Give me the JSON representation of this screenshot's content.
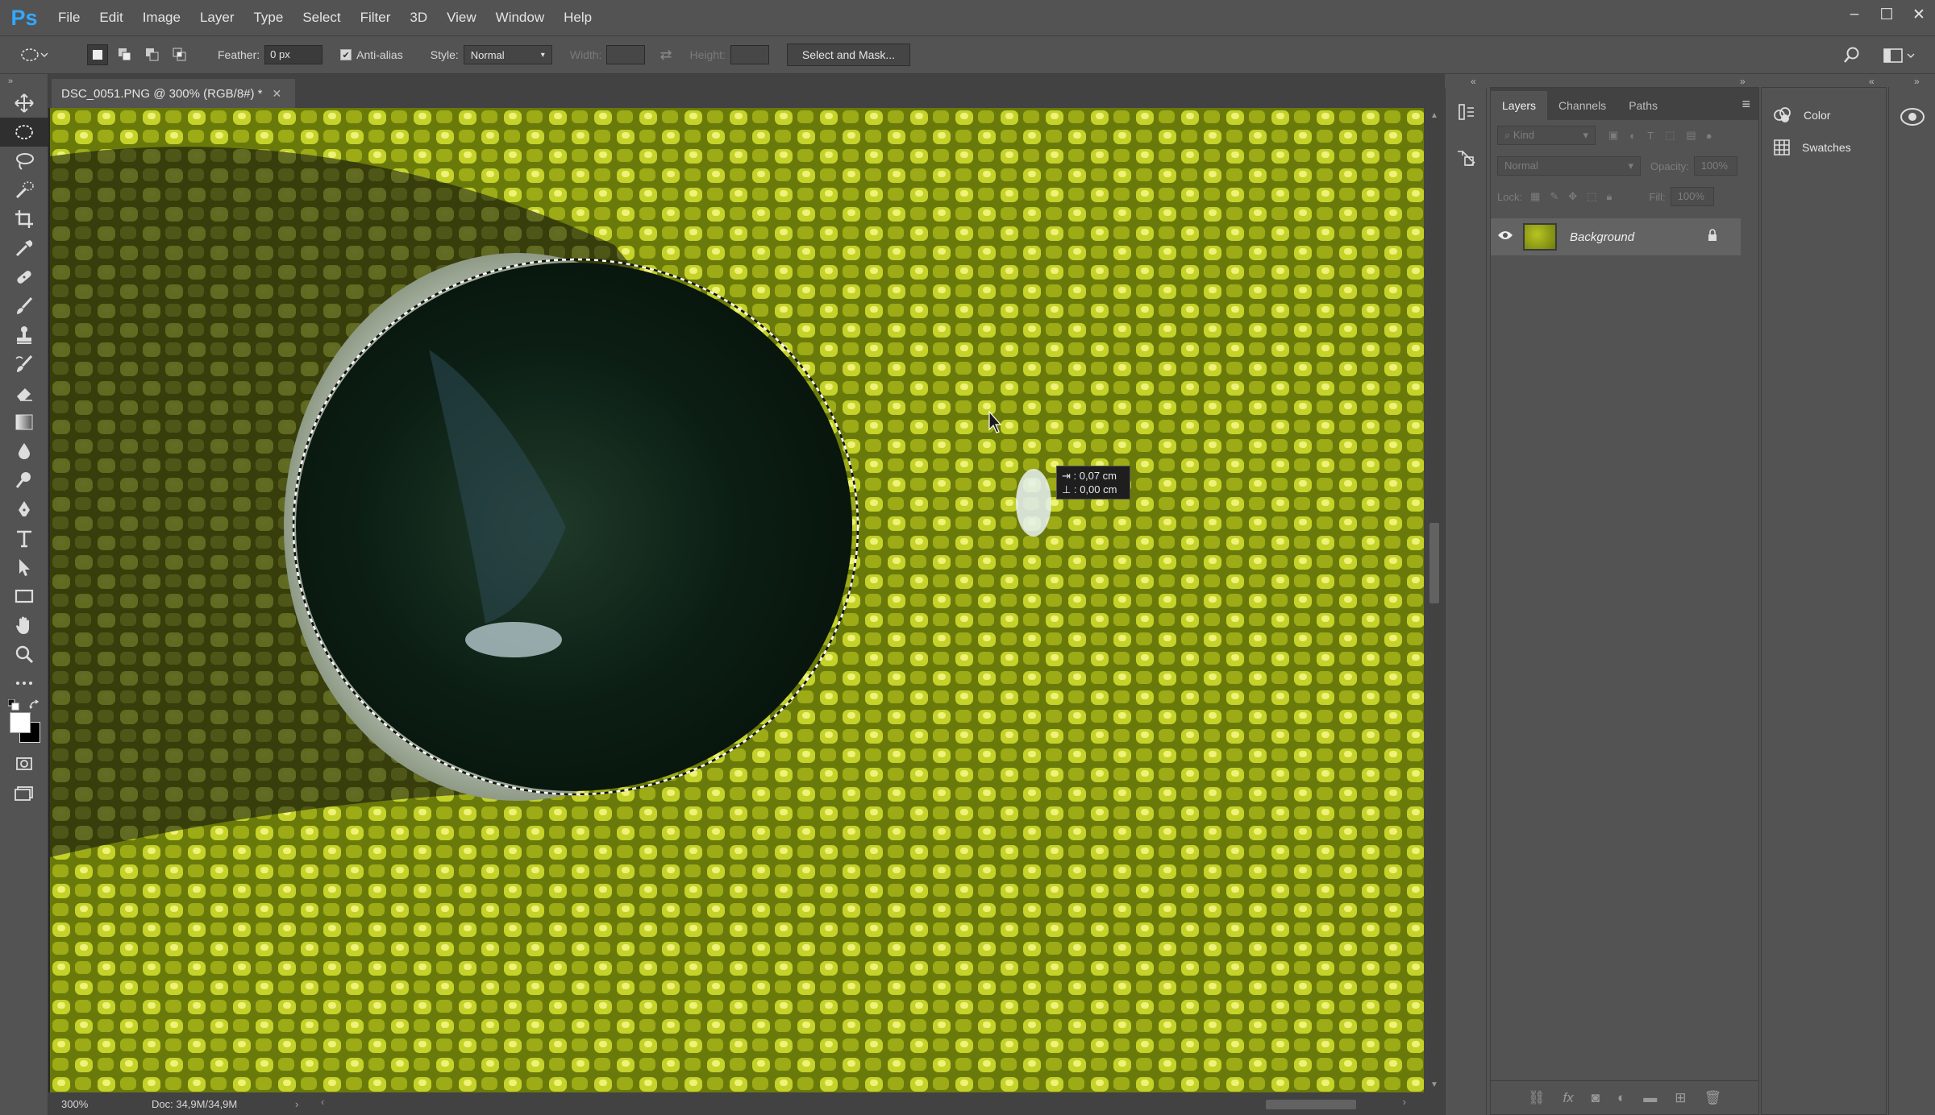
{
  "app": {
    "logo": "Ps",
    "menu": [
      "File",
      "Edit",
      "Image",
      "Layer",
      "Type",
      "Select",
      "Filter",
      "3D",
      "View",
      "Window",
      "Help"
    ],
    "window_controls": [
      "–",
      "☐",
      "✕"
    ]
  },
  "options_bar": {
    "feather_label": "Feather:",
    "feather_value": "0 px",
    "antialias_label": "Anti-alias",
    "style_label": "Style:",
    "style_value": "Normal",
    "width_label": "Width:",
    "height_label": "Height:",
    "select_mask_label": "Select and Mask..."
  },
  "document": {
    "tab_title": "DSC_0051.PNG @ 300% (RGB/8#) *",
    "tooltip_w": "0,07 cm",
    "tooltip_h": "0,00 cm"
  },
  "status": {
    "zoom": "300%",
    "doc": "Doc: 34,9M/34,9M"
  },
  "layers_panel": {
    "tabs": [
      "Layers",
      "Channels",
      "Paths"
    ],
    "filter_kind": "Kind",
    "blend_mode": "Normal",
    "opacity_label": "Opacity:",
    "opacity_value": "100%",
    "lock_label": "Lock:",
    "fill_label": "Fill:",
    "fill_value": "100%",
    "layers": [
      {
        "name": "Background",
        "visible": true,
        "locked": true
      }
    ]
  },
  "right_panels": {
    "items": [
      "Color",
      "Swatches"
    ]
  },
  "colors": {
    "ui_bg": "#535353",
    "fabric": "#b7c423",
    "accent": "#31a8ff"
  }
}
